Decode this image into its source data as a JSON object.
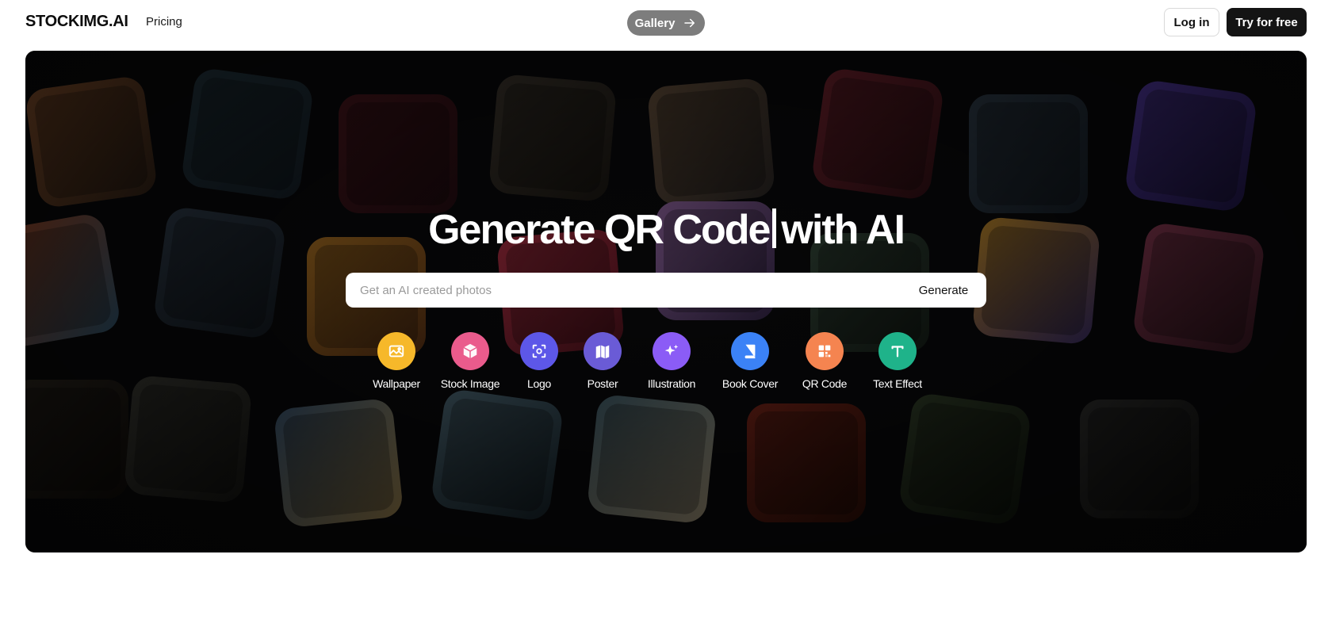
{
  "nav": {
    "logo": "STOCKIMG.AI",
    "pricing": "Pricing",
    "gallery": "Gallery",
    "login": "Log in",
    "try": "Try for free"
  },
  "hero": {
    "headline_left": "Generate QR Code",
    "headline_right": "with AI",
    "search_placeholder": "Get an AI created photos",
    "search_value": "",
    "generate": "Generate"
  },
  "categories": [
    {
      "label": "Wallpaper",
      "icon": "image-icon",
      "color": "#f6b82a"
    },
    {
      "label": "Stock Image",
      "icon": "box-icon",
      "color": "#ea5b8c"
    },
    {
      "label": "Logo",
      "icon": "focus-icon",
      "color": "#5d57e8"
    },
    {
      "label": "Poster",
      "icon": "map-icon",
      "color": "#6a5bd6"
    },
    {
      "label": "Illustration",
      "icon": "sparkles-icon",
      "color": "#8b5cf6"
    },
    {
      "label": "Book Cover",
      "icon": "book-icon",
      "color": "#3b82f6"
    },
    {
      "label": "QR Code",
      "icon": "qr-code-icon",
      "color": "#f58450"
    },
    {
      "label": "Text Effect",
      "icon": "text-icon",
      "color": "#1fb38a"
    }
  ]
}
